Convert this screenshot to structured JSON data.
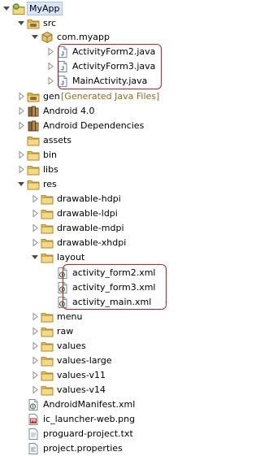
{
  "tree": {
    "rows": [
      {
        "label": "MyApp",
        "icon": "android-project-icon",
        "depth": 0,
        "expanded": true,
        "selected": true
      },
      {
        "label": "src",
        "icon": "source-folder-icon",
        "depth": 1,
        "expanded": true
      },
      {
        "label": "com.myapp",
        "icon": "package-icon",
        "depth": 2,
        "expanded": true
      },
      {
        "label": "ActivityForm2.java",
        "icon": "java-file-icon",
        "depth": 3,
        "expanded": false
      },
      {
        "label": "ActivityForm3.java",
        "icon": "java-file-icon",
        "depth": 3,
        "expanded": false
      },
      {
        "label": "MainActivity.java",
        "icon": "java-file-icon",
        "depth": 3,
        "expanded": false
      },
      {
        "label": "gen",
        "decoration": "[Generated Java Files]",
        "icon": "source-folder-icon",
        "depth": 1,
        "expanded": false
      },
      {
        "label": "Android 4.0",
        "icon": "library-icon",
        "depth": 1,
        "expanded": false
      },
      {
        "label": "Android Dependencies",
        "icon": "library-icon",
        "depth": 1,
        "expanded": false
      },
      {
        "label": "assets",
        "icon": "folder-icon",
        "depth": 1,
        "expanded": null
      },
      {
        "label": "bin",
        "icon": "folder-icon",
        "depth": 1,
        "expanded": false
      },
      {
        "label": "libs",
        "icon": "folder-icon",
        "depth": 1,
        "expanded": false
      },
      {
        "label": "res",
        "icon": "folder-icon",
        "depth": 1,
        "expanded": true
      },
      {
        "label": "drawable-hdpi",
        "icon": "folder-icon",
        "depth": 2,
        "expanded": false
      },
      {
        "label": "drawable-ldpi",
        "icon": "folder-icon",
        "depth": 2,
        "expanded": false
      },
      {
        "label": "drawable-mdpi",
        "icon": "folder-icon",
        "depth": 2,
        "expanded": false
      },
      {
        "label": "drawable-xhdpi",
        "icon": "folder-icon",
        "depth": 2,
        "expanded": false
      },
      {
        "label": "layout",
        "icon": "folder-icon",
        "depth": 2,
        "expanded": true
      },
      {
        "label": "activity_form2.xml",
        "icon": "xml-file-icon",
        "depth": 3,
        "expanded": null
      },
      {
        "label": "activity_form3.xml",
        "icon": "xml-file-icon",
        "depth": 3,
        "expanded": null
      },
      {
        "label": "activity_main.xml",
        "icon": "xml-file-icon",
        "depth": 3,
        "expanded": null
      },
      {
        "label": "menu",
        "icon": "folder-icon",
        "depth": 2,
        "expanded": false
      },
      {
        "label": "raw",
        "icon": "folder-icon",
        "depth": 2,
        "expanded": false
      },
      {
        "label": "values",
        "icon": "folder-icon",
        "depth": 2,
        "expanded": false
      },
      {
        "label": "values-large",
        "icon": "folder-icon",
        "depth": 2,
        "expanded": false
      },
      {
        "label": "values-v11",
        "icon": "folder-icon",
        "depth": 2,
        "expanded": false
      },
      {
        "label": "values-v14",
        "icon": "folder-icon",
        "depth": 2,
        "expanded": false
      },
      {
        "label": "AndroidManifest.xml",
        "icon": "xml-file-icon",
        "depth": 1,
        "expanded": null
      },
      {
        "label": "ic_launcher-web.png",
        "icon": "image-file-icon",
        "depth": 1,
        "expanded": null
      },
      {
        "label": "proguard-project.txt",
        "icon": "text-file-icon",
        "depth": 1,
        "expanded": null
      },
      {
        "label": "project.properties",
        "icon": "properties-file-icon",
        "depth": 1,
        "expanded": null
      }
    ]
  },
  "colors": {
    "highlight": "#c81e1e",
    "selection": "#d7e6f7",
    "folder": "#e9c35a",
    "decoration": "#8a6a1c"
  }
}
